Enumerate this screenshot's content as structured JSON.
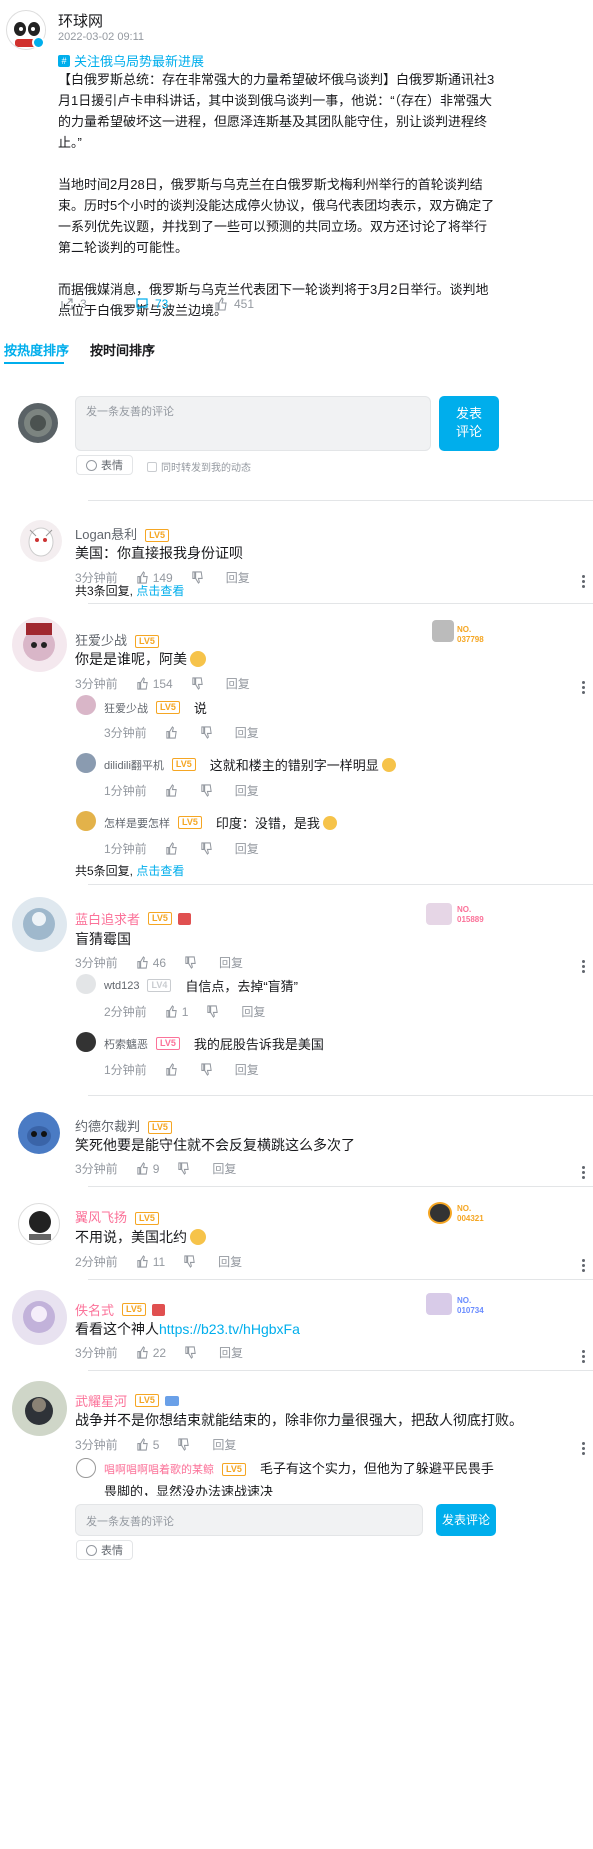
{
  "post": {
    "author": "环球网",
    "time": "2022-03-02 09:11",
    "topic": "关注俄乌局势最新进展",
    "para1": "【白俄罗斯总统：存在非常强大的力量希望破坏俄乌谈判】白俄罗斯通讯社3月1日援引卢卡申科讲话，其中谈到俄乌谈判一事，他说：“（存在）非常强大的力量希望破坏这一进程，但愿泽连斯基及其团队能守住，别让谈判进程终止。”",
    "para2": "当地时间2月28日，俄罗斯与乌克兰在白俄罗斯戈梅利州举行的首轮谈判结束。历时5个小时的谈判没能达成停火协议，俄乌代表团均表示，双方确定了一系列优先议题，并找到了一些可以预测的共同立场。双方还讨论了将举行第二轮谈判的可能性。",
    "para3": "而据俄媒消息，俄罗斯与乌克兰代表团下一轮谈判将于3月2日举行。谈判地点位于白俄罗斯与波兰边境。",
    "shares": "3",
    "comments": "73",
    "likes": "451"
  },
  "tabs": [
    "按热度排序",
    "按时间排序"
  ],
  "editor": {
    "placeholder": "发一条友善的评论",
    "submit": "发表\n评论",
    "submit_bottom": "发表评论",
    "emoji": "表情",
    "forward": "同时转发到我的动态"
  },
  "comments": [
    {
      "user": "Logan悬利",
      "level": "LV5",
      "text": "美国：你直接报我身份证呗",
      "time": "3分钟前",
      "likes": "149",
      "reply": "回复",
      "total": "共3条回复,",
      "more": "点击查看"
    },
    {
      "user": "狂爱少战",
      "level": "LV5",
      "text": "你是是谁呢，阿美",
      "time": "3分钟前",
      "likes": "154",
      "reply": "回复",
      "badge": "NO.\n037798",
      "subs": [
        {
          "user": "狂爱少战",
          "level": "LV5",
          "text": "说",
          "time": "3分钟前"
        },
        {
          "user": "dilidili翻平机",
          "level": "LV5",
          "text": "这就和楼主的错别字一样明显",
          "time": "1分钟前"
        },
        {
          "user": "怎样是要怎样",
          "level": "LV5",
          "text": "印度：没错，是我",
          "time": "1分钟前"
        }
      ],
      "total": "共5条回复,",
      "more": "点击查看"
    },
    {
      "user": "蓝白追求者",
      "level": "LV5",
      "text": "盲猜霉国",
      "time": "3分钟前",
      "likes": "46",
      "reply": "回复",
      "badge": "NO.\n015889",
      "subs": [
        {
          "user": "wtd123",
          "level": "LV4",
          "text": "自信点，去掉“盲猜”",
          "time": "2分钟前",
          "likes": "1"
        },
        {
          "user": "朽索魑恶",
          "level": "LV5",
          "text": "我的屁股告诉我是美国",
          "time": "1分钟前"
        }
      ]
    },
    {
      "user": "约德尔裁判",
      "level": "LV5",
      "text": "笑死他要是能守住就不会反复横跳这么多次了",
      "time": "3分钟前",
      "likes": "9",
      "reply": "回复"
    },
    {
      "user": "翼风飞扬",
      "level": "LV5",
      "text": "不用说，美国北约",
      "time": "2分钟前",
      "likes": "11",
      "reply": "回复",
      "badge": "NO.\n004321"
    },
    {
      "user": "佚名式",
      "level": "LV5",
      "text": "看看这个神人",
      "link": "https://b23.tv/hHgbxFa",
      "time": "3分钟前",
      "likes": "22",
      "reply": "回复",
      "badge": "NO.\n010734"
    },
    {
      "user": "武耀星河",
      "level": "LV5",
      "text": "战争并不是你想结束就能结束的，除非你力量很强大，把敌人彻底打败。",
      "time": "3分钟前",
      "likes": "5",
      "reply": "回复",
      "subs": [
        {
          "user": "唱啊唱啊唱着歌的某鲸",
          "level": "LV5",
          "text": "毛子有这个实力，但他为了躲避平民畏手畏脚的，显然没办法速战速决"
        }
      ]
    }
  ],
  "colors": {
    "accent": "#00aeec",
    "pink": "#fb7299",
    "level": "#f5a623"
  }
}
